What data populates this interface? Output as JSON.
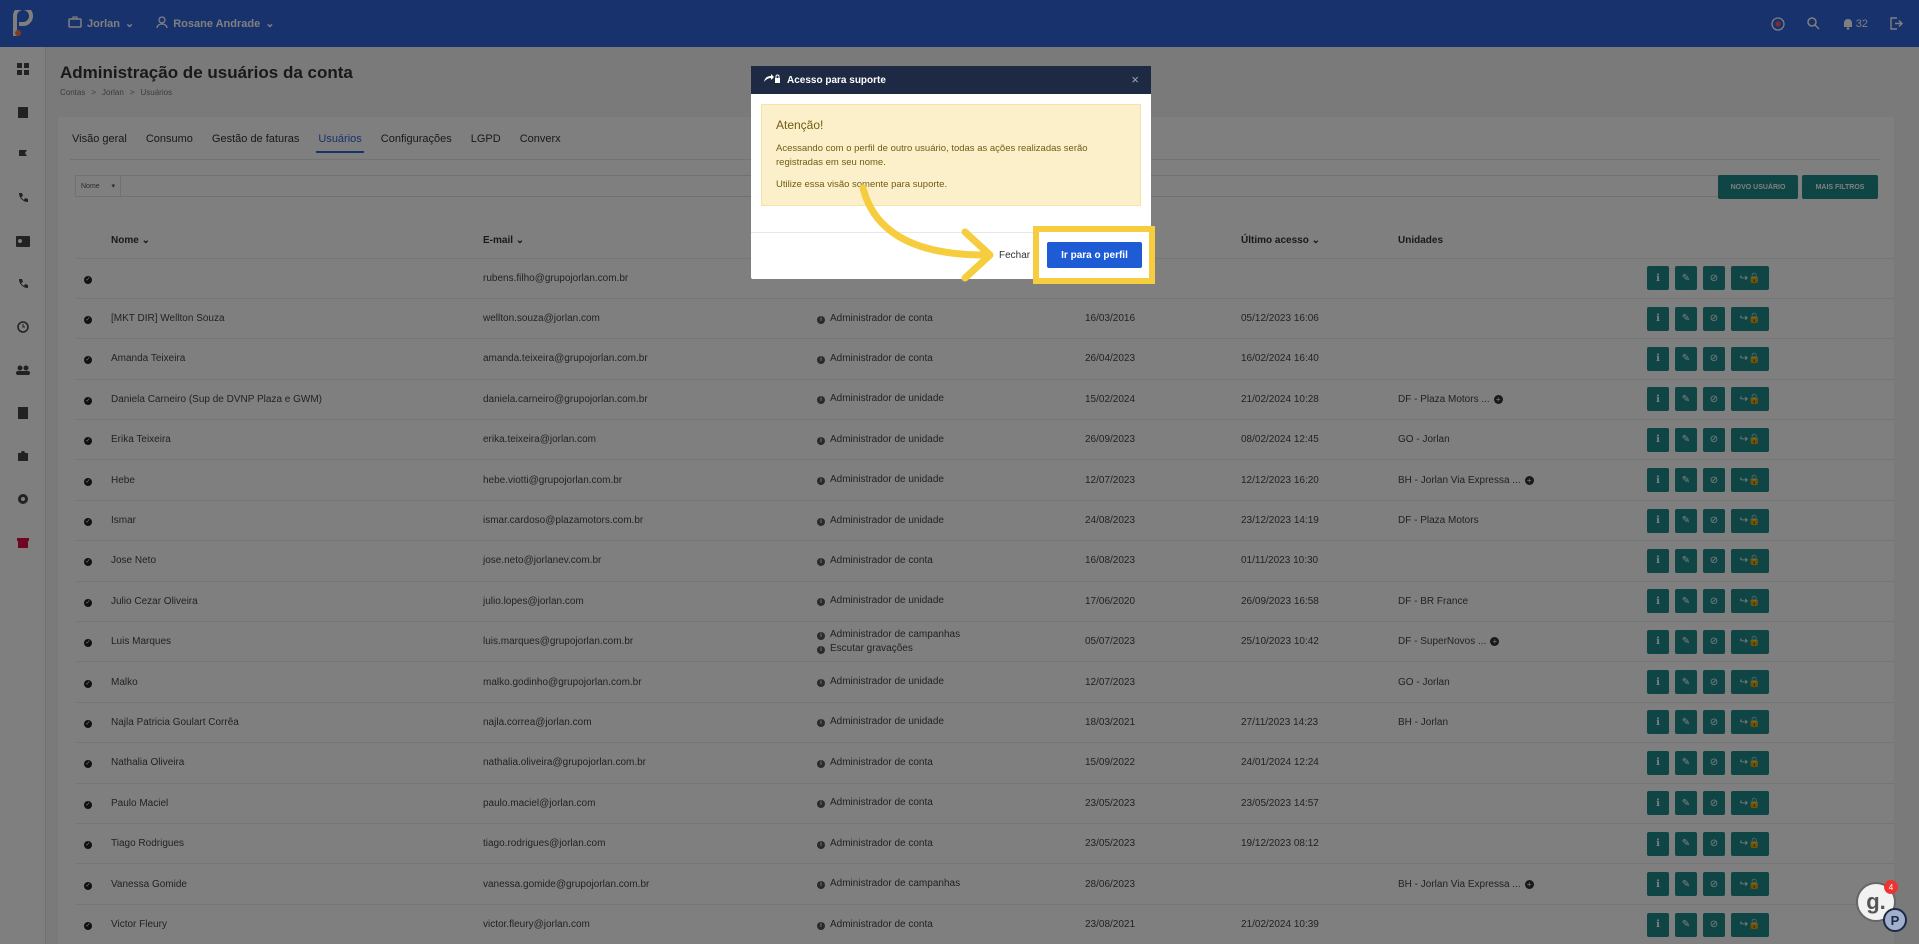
{
  "topbar": {
    "account": "Jorlan",
    "user": "Rosane Andrade",
    "notifications": "32"
  },
  "page": {
    "title": "Administração de usuários da conta",
    "breadcrumb": [
      "Contas",
      ">",
      "Jorlan",
      ">",
      "Usuários"
    ]
  },
  "tabs": [
    "Visão geral",
    "Consumo",
    "Gestão de faturas",
    "Usuários",
    "Configurações",
    "LGPD",
    "Converx"
  ],
  "filter": {
    "select": "Nome"
  },
  "buttons": {
    "new_user": "NOVO USUÁRIO",
    "more_filters": "MAIS FILTROS"
  },
  "table": {
    "headers": {
      "name": "Nome",
      "email": "E-mail",
      "last_access": "Último acesso",
      "units": "Unidades"
    },
    "rows": [
      {
        "name": "",
        "email": "rubens.filho@grupojorlan.com.br",
        "roles": [],
        "created": "",
        "last": "",
        "unit": "",
        "more": false
      },
      {
        "name": "[MKT DIR] Wellton Souza",
        "email": "wellton.souza@jorlan.com",
        "roles": [
          "Administrador de conta"
        ],
        "created": "16/03/2016",
        "last": "05/12/2023 16:06",
        "unit": "",
        "more": false
      },
      {
        "name": "Amanda Teixeira",
        "email": "amanda.teixeira@grupojorlan.com.br",
        "roles": [
          "Administrador de conta"
        ],
        "created": "26/04/2023",
        "last": "16/02/2024 16:40",
        "unit": "",
        "more": false
      },
      {
        "name": "Daniela Carneiro (Sup de DVNP Plaza e GWM)",
        "email": "daniela.carneiro@grupojorlan.com.br",
        "roles": [
          "Administrador de unidade"
        ],
        "created": "15/02/2024",
        "last": "21/02/2024 10:28",
        "unit": "DF - Plaza Motors ...",
        "more": true
      },
      {
        "name": "Erika Teixeira",
        "email": "erika.teixeira@jorlan.com",
        "roles": [
          "Administrador de unidade"
        ],
        "created": "26/09/2023",
        "last": "08/02/2024 12:45",
        "unit": "GO - Jorlan",
        "more": false
      },
      {
        "name": "Hebe",
        "email": "hebe.viotti@grupojorlan.com.br",
        "roles": [
          "Administrador de unidade"
        ],
        "created": "12/07/2023",
        "last": "12/12/2023 16:20",
        "unit": "BH - Jorlan Via Expressa ...",
        "more": true
      },
      {
        "name": "Ismar",
        "email": "ismar.cardoso@plazamotors.com.br",
        "roles": [
          "Administrador de unidade"
        ],
        "created": "24/08/2023",
        "last": "23/12/2023 14:19",
        "unit": "DF - Plaza Motors",
        "more": false
      },
      {
        "name": "Jose Neto",
        "email": "jose.neto@jorlanev.com.br",
        "roles": [
          "Administrador de conta"
        ],
        "created": "16/08/2023",
        "last": "01/11/2023 10:30",
        "unit": "",
        "more": false
      },
      {
        "name": "Julio Cezar Oliveira",
        "email": "julio.lopes@jorlan.com",
        "roles": [
          "Administrador de unidade"
        ],
        "created": "17/06/2020",
        "last": "26/09/2023 16:58",
        "unit": "DF - BR France",
        "more": false
      },
      {
        "name": "Luis Marques",
        "email": "luis.marques@grupojorlan.com.br",
        "roles": [
          "Administrador de campanhas",
          "Escutar gravações"
        ],
        "created": "05/07/2023",
        "last": "25/10/2023 10:42",
        "unit": "DF - SuperNovos ...",
        "more": true
      },
      {
        "name": "Malko",
        "email": "malko.godinho@grupojorlan.com.br",
        "roles": [
          "Administrador de unidade"
        ],
        "created": "12/07/2023",
        "last": "",
        "unit": "GO - Jorlan",
        "more": false
      },
      {
        "name": "Najla Patricia Goulart Corrêa",
        "email": "najla.correa@jorlan.com",
        "roles": [
          "Administrador de unidade"
        ],
        "created": "18/03/2021",
        "last": "27/11/2023 14:23",
        "unit": "BH - Jorlan",
        "more": false
      },
      {
        "name": "Nathalia Oliveira",
        "email": "nathalia.oliveira@grupojorlan.com.br",
        "roles": [
          "Administrador de conta"
        ],
        "created": "15/09/2022",
        "last": "24/01/2024 12:24",
        "unit": "",
        "more": false
      },
      {
        "name": "Paulo Maciel",
        "email": "paulo.maciel@jorlan.com",
        "roles": [
          "Administrador de conta"
        ],
        "created": "23/05/2023",
        "last": "23/05/2023 14:57",
        "unit": "",
        "more": false
      },
      {
        "name": "Tiago Rodrigues",
        "email": "tiago.rodrigues@jorlan.com",
        "roles": [
          "Administrador de conta"
        ],
        "created": "23/05/2023",
        "last": "19/12/2023 08:12",
        "unit": "",
        "more": false
      },
      {
        "name": "Vanessa Gomide",
        "email": "vanessa.gomide@grupojorlan.com.br",
        "roles": [
          "Administrador de campanhas"
        ],
        "created": "28/06/2023",
        "last": "",
        "unit": "BH - Jorlan Via Expressa ...",
        "more": true
      },
      {
        "name": "Victor Fleury",
        "email": "victor.fleury@jorlan.com",
        "roles": [
          "Administrador de conta"
        ],
        "created": "23/08/2021",
        "last": "21/02/2024 10:39",
        "unit": "",
        "more": false
      }
    ]
  },
  "modal": {
    "title": "Acesso para suporte",
    "alert_title": "Atenção!",
    "alert_p1": "Acessando com o perfil de outro usuário, todas as ações realizadas serão registradas em seu nome.",
    "alert_p2": "Utilize essa visão somente para suporte.",
    "close_label": "Fechar",
    "primary_label": "Ir para o perfil"
  },
  "help_widget": {
    "badge": "4"
  },
  "colors": {
    "brand": "#2f64d8",
    "teal": "#1f8a8a",
    "highlight": "#f6cd3f"
  }
}
